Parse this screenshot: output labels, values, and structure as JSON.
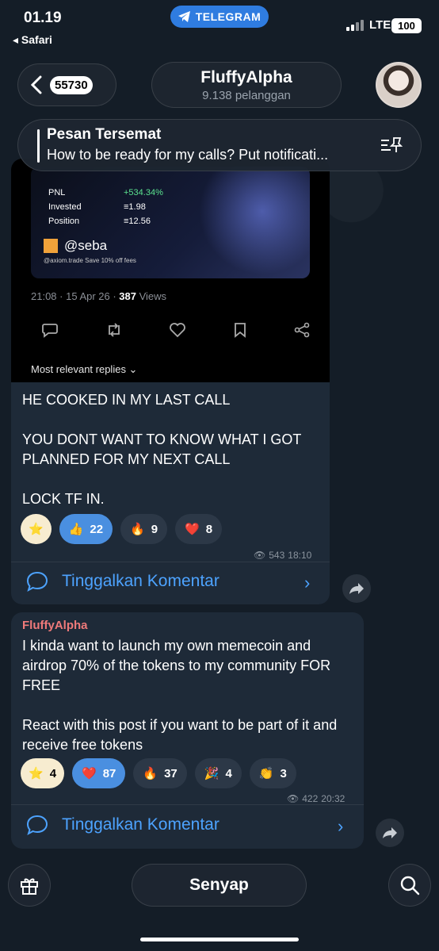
{
  "status_bar": {
    "time": "01.19",
    "back_app": "◂ Safari",
    "app_pill": "TELEGRAM",
    "network": "LTE",
    "battery": "100"
  },
  "header": {
    "back_count": "55730",
    "title": "FluffyAlpha",
    "subtitle": "9.138 pelanggan"
  },
  "pinned": {
    "title": "Pesan Tersemat",
    "text": "How to be ready for my calls? Put notificati..."
  },
  "message1": {
    "card": {
      "pnl_label": "PNL",
      "pnl_value": "+534.34%",
      "invested_label": "Invested",
      "invested_value": "≡1.98",
      "position_label": "Position",
      "position_value": "≡12.56",
      "handle": "@seba",
      "site": "@axiom.trade   Save 10% off fees"
    },
    "meta_time": "21:08 · 15 Apr 26 · ",
    "meta_views": "387",
    "meta_views_label": " Views",
    "replies": "Most relevant replies ⌄",
    "text_lines": [
      "HE COOKED IN MY LAST CALL",
      "",
      "YOU DONT WANT TO KNOW WHAT I GOT PLANNED FOR MY NEXT CALL",
      "",
      "LOCK TF IN."
    ],
    "reactions": [
      {
        "emoji": "⭐",
        "count": ""
      },
      {
        "emoji": "👍",
        "count": "22"
      },
      {
        "emoji": "🔥",
        "count": "9"
      },
      {
        "emoji": "❤️",
        "count": "8"
      }
    ],
    "views": "543",
    "time": "18:10",
    "comment": "Tinggalkan Komentar"
  },
  "message2": {
    "sender": "FluffyAlpha",
    "text_lines": [
      "I kinda want to launch my own memecoin and airdrop 70% of the tokens to my community FOR FREE",
      "",
      "React with this post if you want to be part of it and receive free tokens"
    ],
    "reactions": [
      {
        "emoji": "⭐",
        "count": "4"
      },
      {
        "emoji": "❤️",
        "count": "87"
      },
      {
        "emoji": "🔥",
        "count": "37"
      },
      {
        "emoji": "🎉",
        "count": "4"
      },
      {
        "emoji": "👏",
        "count": "3"
      }
    ],
    "views": "422",
    "time": "20:32",
    "comment": "Tinggalkan Komentar"
  },
  "bottom": {
    "mute_label": "Senyap"
  },
  "colors": {
    "accent": "#4da3ff",
    "sender": "#ef7a7a",
    "bubble": "#1e2a38"
  }
}
